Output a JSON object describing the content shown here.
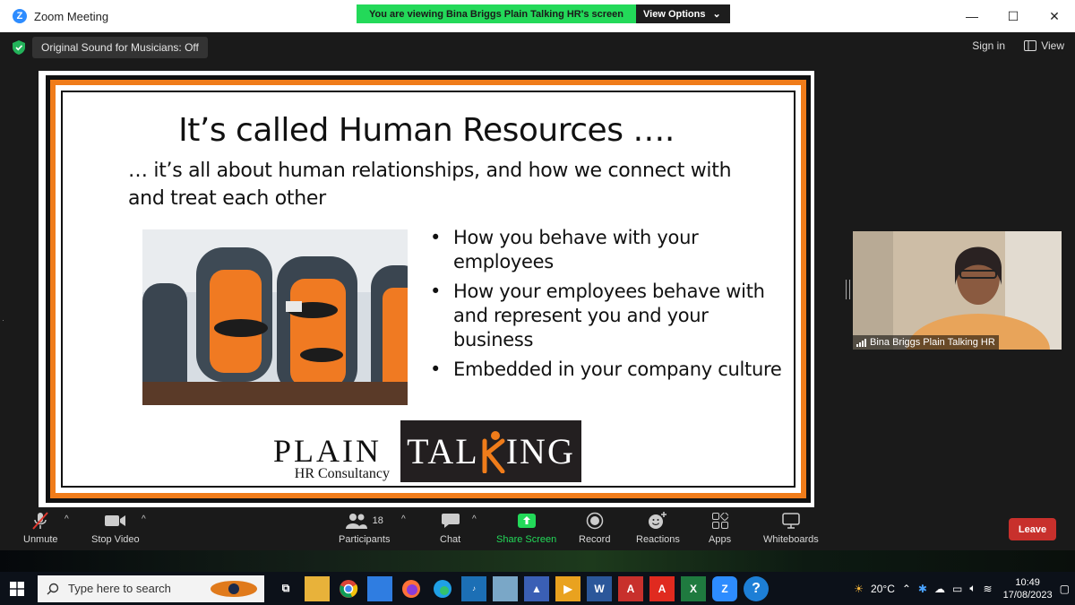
{
  "window": {
    "title": "Zoom Meeting",
    "banner_message": "You are viewing Bina Briggs Plain Talking HR's screen",
    "view_options_label": "View Options",
    "controls": {
      "minimize": "—",
      "maximize": "☐",
      "close": "✕"
    }
  },
  "meeting_header": {
    "sound_label": "Original Sound for Musicians: Off",
    "signin_label": "Sign in",
    "view_label": "View"
  },
  "slide": {
    "title": "It’s called Human Resources ….",
    "subtitle": "… it’s all about human relationships, and how we connect with and treat each other",
    "bullets": [
      "How you behave with your employees",
      "How your employees behave with and represent you and your business",
      "Embedded in your company culture"
    ],
    "logo_plain": "PLAIN",
    "logo_consultancy": "HR Consultancy",
    "logo_talking_left": "TAL",
    "logo_talking_right": "ING",
    "accent_color": "#f07c1a"
  },
  "participant": {
    "name": "Bina Briggs Plain Talking HR"
  },
  "toolbar": {
    "unmute": "Unmute",
    "stop_video": "Stop Video",
    "participants": "Participants",
    "participants_count": "18",
    "chat": "Chat",
    "share_screen": "Share Screen",
    "record": "Record",
    "reactions": "Reactions",
    "apps": "Apps",
    "whiteboards": "Whiteboards",
    "leave": "Leave",
    "share_color": "#23d959",
    "leave_color": "#c8302c"
  },
  "taskbar": {
    "search_placeholder": "Type here to search",
    "temperature": "20°C",
    "time": "10:49",
    "date": "17/08/2023"
  }
}
